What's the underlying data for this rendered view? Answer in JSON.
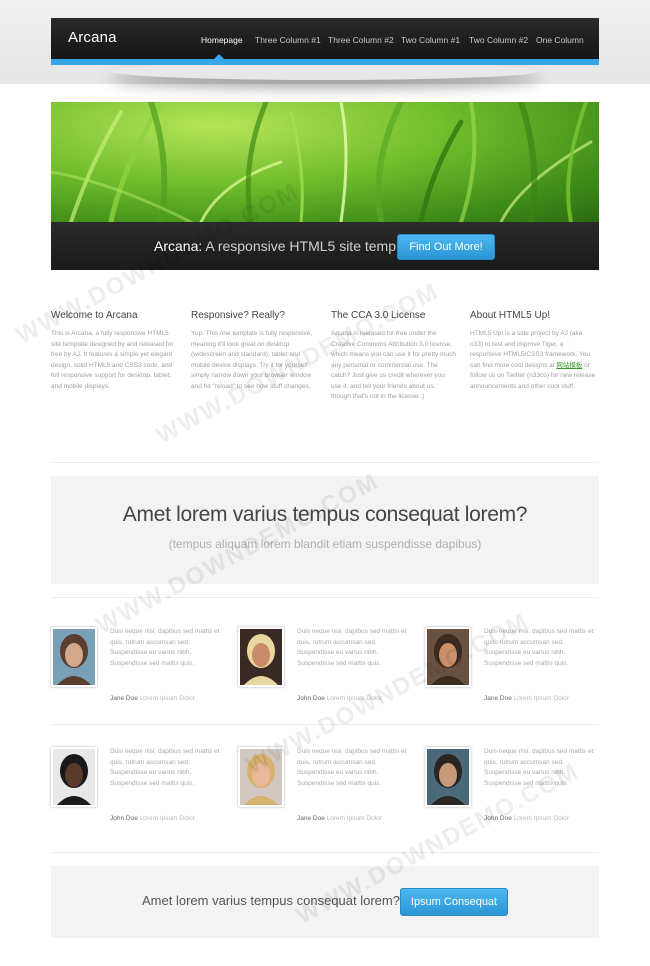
{
  "brand": {
    "name": "Arcana",
    "accent": "#37a5e6"
  },
  "nav": {
    "items": [
      "Homepage",
      "Three Column #1",
      "Three Column #2",
      "Two Column #1",
      "Two Column #2",
      "One Column"
    ],
    "active": "Homepage"
  },
  "banner": {
    "title_strong": "Arcana:",
    "title_rest": " A responsive HTML5 site template",
    "button": "Find Out More!"
  },
  "columns": [
    {
      "title": "Welcome to Arcana",
      "body": "This is Arcana, a fully responsive HTML5 site template designed by and released for free by AJ. It features a simple yet elegant design, solid HTML5 and CSS3 code, and full responsive support for desktop, tablet, and mobile displays."
    },
    {
      "title": "Responsive? Really?",
      "body": "Yup. This one template is fully responsive, meaning it'll look great on desktop (widescreen and standard), tablet and mobile device displays. Try it for yourself: simply narrow down your browser window and hit \"reload\" to see how stuff changes."
    },
    {
      "title": "The CCA 3.0 License",
      "body": "Arcana is released for free under the Creative Commons Attribution 3.0 license, which means you can use it for pretty much any personal or commercial use. The catch? Just give us credit wherever you use it, and tell your friends about us, though that's not in the license :)"
    },
    {
      "title": "About HTML5 Up!",
      "body_before": "HTML5 Up! is a side project by AJ (aka n33) to test and improve Tiger, a responsive HTML5/CSS3 framework. You can find more cool designs at ",
      "link": "网站模板",
      "body_after": " or follow us on Twitter (n33co) for new release announcements and other cool stuff."
    }
  ],
  "feature": {
    "title": "Amet lorem varius tempus consequat lorem?",
    "subtitle": "(tempus aliquam lorem blandit etiam suspendisse dapibus)"
  },
  "testimonials": [
    {
      "text": "Duis neque nisi, dapibus sed mattis et quis, rutrum accumsan sed. Suspendisse eu varius nibh. Suspendisse sed mattis quis.",
      "name": "Jane Doe",
      "role": "Lorem Ipsum Dolor",
      "palette": [
        "#5a3e30",
        "#d4a88a",
        "#7aa0b8"
      ]
    },
    {
      "text": "Duis neque nisi, dapibus sed mattis et quis, rutrum accumsan sed. Suspendisse eu varius nibh. Suspendisse sed mattis quis.",
      "name": "John Doe",
      "role": "Lorem Ipsum Dolor",
      "palette": [
        "#e8d8a0",
        "#c98a6a",
        "#3a2a25"
      ]
    },
    {
      "text": "Duis neque nisi, dapibus sed mattis et quis, rutrum accumsan sed. Suspendisse eu varius nibh. Suspendisse sed mattis quis.",
      "name": "Jane Doe",
      "role": "Lorem Ipsum Dolor",
      "palette": [
        "#3a2a20",
        "#c9906a",
        "#6a5040"
      ]
    },
    {
      "text": "Duis neque nisi, dapibus sed mattis et quis, rutrum accumsan sed. Suspendisse eu varius nibh. Suspendisse sed mattis quis.",
      "name": "John Doe",
      "role": "Lorem Ipsum Dolor",
      "palette": [
        "#1a1a1a",
        "#5a3a28",
        "#e8e8e8"
      ]
    },
    {
      "text": "Duis neque nisi, dapibus sed mattis et quis, rutrum accumsan sed. Suspendisse eu varius nibh. Suspendisse sed mattis quis.",
      "name": "Jane Doe",
      "role": "Lorem Ipsum Dolor",
      "palette": [
        "#d8b070",
        "#e8b898",
        "#d0c8c0"
      ]
    },
    {
      "text": "Duis neque nisi, dapibus sed mattis et quis, rutrum accumsan sed. Suspendisse eu varius nibh. Suspendisse sed mattis quis.",
      "name": "John Doe",
      "role": "Lorem Ipsum Dolor",
      "palette": [
        "#2a2520",
        "#c89a7a",
        "#4a6a7a"
      ]
    }
  ],
  "cta": {
    "text": "Amet lorem varius tempus consequat lorem?",
    "button": "Ipsum Consequat"
  },
  "watermark": "WWW.DOWNDEMO.COM"
}
